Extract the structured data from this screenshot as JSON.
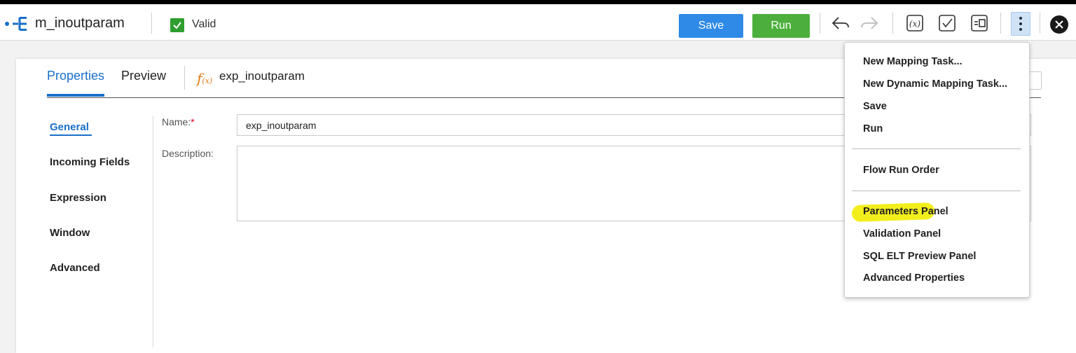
{
  "header": {
    "mapping_name": "m_inoutparam",
    "status_label": "Valid",
    "save_label": "Save",
    "run_label": "Run",
    "colors": {
      "save": "#2e8ae6",
      "run": "#4caf3c",
      "valid": "#2e9e2e"
    },
    "icons": [
      "mapping-icon",
      "check-icon",
      "undo-icon",
      "redo-icon",
      "parameter-icon",
      "validate-icon",
      "preview-panel-icon",
      "more-actions-icon",
      "close-icon"
    ]
  },
  "tabs": [
    {
      "label": "Properties",
      "active": true
    },
    {
      "label": "Preview",
      "active": false
    }
  ],
  "transformation": {
    "icon_text": "f",
    "icon_sub": "(x)",
    "name": "exp_inoutparam"
  },
  "sidebar": {
    "items": [
      {
        "label": "General",
        "active": true
      },
      {
        "label": "Incoming Fields"
      },
      {
        "label": "Expression"
      },
      {
        "label": "Window"
      },
      {
        "label": "Advanced"
      }
    ]
  },
  "form": {
    "name_label": "Name:",
    "required_marker": "*",
    "name_value": "exp_inoutparam",
    "description_label": "Description:",
    "description_value": ""
  },
  "menu": {
    "items": [
      {
        "label": "New Mapping Task..."
      },
      {
        "label": "New Dynamic Mapping Task..."
      },
      {
        "label": "Save"
      },
      {
        "label": "Run"
      },
      {
        "label": "Flow Run Order"
      },
      {
        "label": "Parameters Panel",
        "highlighted": true
      },
      {
        "label": "Validation Panel"
      },
      {
        "label": "SQL ELT Preview Panel"
      },
      {
        "label": "Advanced Properties"
      }
    ],
    "highlight_color": "#f2ee1c"
  }
}
